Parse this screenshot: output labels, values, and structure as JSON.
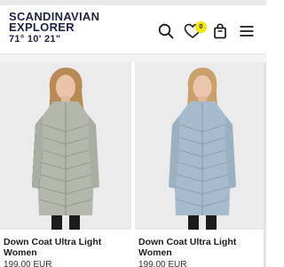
{
  "brand": {
    "line1": "SCANDINAVIAN",
    "line2": "EXPLORER",
    "line3": "71° 10' 21\""
  },
  "header": {
    "wishlist_count": "0",
    "icons": [
      "search-icon",
      "heart-icon",
      "shopping-bag-icon",
      "menu-icon"
    ]
  },
  "products": [
    {
      "title": "Down Coat Ultra Light Women",
      "price": "199,00 EUR",
      "color": "#b4b7ab"
    },
    {
      "title": "Down Coat Ultra Light Women",
      "price": "199,00 EUR",
      "color": "#a6bccd"
    }
  ],
  "colors": {
    "brand_navy": "#1e2244",
    "badge_yellow": "#f2e600"
  }
}
